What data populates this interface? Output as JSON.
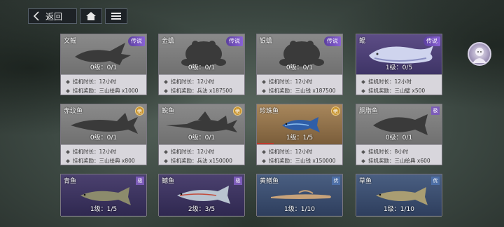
{
  "topbar": {
    "back_label": "返回",
    "home_icon": "home-icon",
    "list_icon": "list-icon"
  },
  "labels": {
    "duration_prefix": "挂机时长：",
    "reward_prefix": "挂机奖励："
  },
  "cards": [
    {
      "name": "文鳐",
      "badge": "传说",
      "level": "0级：0/1",
      "duration": "12小时",
      "reward": "三山绘典 x1000"
    },
    {
      "name": "金蟾",
      "badge": "传说",
      "level": "0级：0/1",
      "duration": "12小时",
      "reward": "兵法 x187500"
    },
    {
      "name": "银蟾",
      "badge": "传说",
      "level": "0级：0/1",
      "duration": "12小时",
      "reward": "三山钱 x187500"
    },
    {
      "name": "鲲",
      "badge": "传说",
      "level": "1级：0/5",
      "duration": "12小时",
      "reward": "三山璧 x500"
    },
    {
      "name": "赤纹鱼",
      "badge": "绝",
      "level": "0级：0/1",
      "duration": "12小时",
      "reward": "三山绘典 x800"
    },
    {
      "name": "鲵鱼",
      "badge": "绝",
      "level": "0级：0/1",
      "duration": "12小时",
      "reward": "兵法 x150000"
    },
    {
      "name": "珍珠鱼",
      "badge": "绝",
      "level": "1级：1/5",
      "duration": "12小时",
      "reward": "三山钱 x150000",
      "progress": 0.2
    },
    {
      "name": "胴脂鱼",
      "badge": "极",
      "level": "0级：0/1",
      "duration": "8小时",
      "reward": "三山绘典 x600"
    },
    {
      "name": "青鱼",
      "badge": "极",
      "level": "1级：1/5"
    },
    {
      "name": "鳡鱼",
      "badge": "极",
      "level": "2级：3/5"
    },
    {
      "name": "黄鳝鱼",
      "badge": "优",
      "level": "1级：1/10"
    },
    {
      "name": "草鱼",
      "badge": "优",
      "level": "1级：1/10"
    }
  ]
}
